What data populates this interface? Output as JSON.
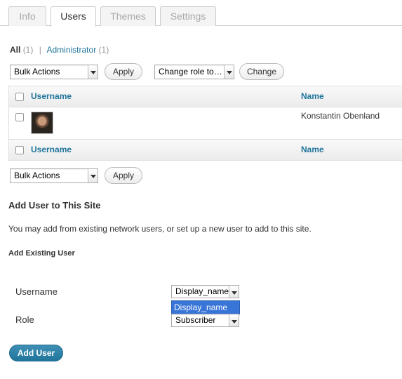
{
  "tabs": [
    {
      "label": "Info",
      "active": false
    },
    {
      "label": "Users",
      "active": true
    },
    {
      "label": "Themes",
      "active": false
    },
    {
      "label": "Settings",
      "active": false
    }
  ],
  "filters": {
    "all_label": "All",
    "all_count": "(1)",
    "separator": "|",
    "admin_label": "Administrator",
    "admin_count": "(1)"
  },
  "top_actions": {
    "bulk_select": "Bulk Actions",
    "apply_label": "Apply",
    "role_select": "Change role to…",
    "change_label": "Change"
  },
  "table": {
    "columns": [
      "Username",
      "Name"
    ],
    "rows": [
      {
        "username": "",
        "name": "Konstantin Obenland",
        "avatar_icon": "user-avatar"
      }
    ]
  },
  "bottom_actions": {
    "bulk_select": "Bulk Actions",
    "apply_label": "Apply"
  },
  "add_user": {
    "title": "Add User to This Site",
    "description": "You may add from existing network users, or set up a new user to add to this site.",
    "subtitle": "Add Existing User",
    "username_label": "Username",
    "username_value": "Display_name",
    "username_dropdown_option": "Display_name",
    "role_label": "Role",
    "role_value": "Subscriber",
    "submit_label": "Add User"
  },
  "colors": {
    "link": "#21759b",
    "primary_button": "#21759b",
    "dropdown_highlight": "#3875d7"
  }
}
